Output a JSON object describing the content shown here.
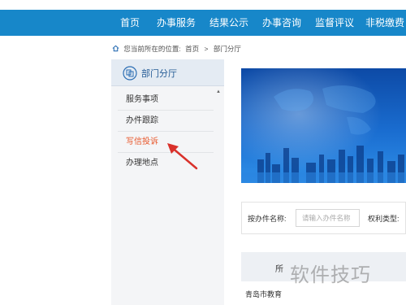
{
  "nav": {
    "items": [
      {
        "label": "首页"
      },
      {
        "label": "办事服务"
      },
      {
        "label": "结果公示"
      },
      {
        "label": "办事咨询"
      },
      {
        "label": "监督评议"
      },
      {
        "label": "非税缴费"
      }
    ],
    "color": "#1787c9"
  },
  "breadcrumb": {
    "prefix": "您当前所在的位置:",
    "home": "首页",
    "separator": ">",
    "current": "部门分厅"
  },
  "sidebar": {
    "title": "部门分厅",
    "items": [
      {
        "label": "服务事项"
      },
      {
        "label": "办件跟踪"
      },
      {
        "label": "写信投诉"
      },
      {
        "label": "办理地点"
      }
    ],
    "active_color": "#e8562a"
  },
  "filter": {
    "name_label": "按办件名称:",
    "name_placeholder": "请输入办件名称",
    "type_label": "权利类型:"
  },
  "table": {
    "header_partial": "所",
    "first_row_partial": "青岛市教育"
  },
  "watermark": "软件技巧"
}
